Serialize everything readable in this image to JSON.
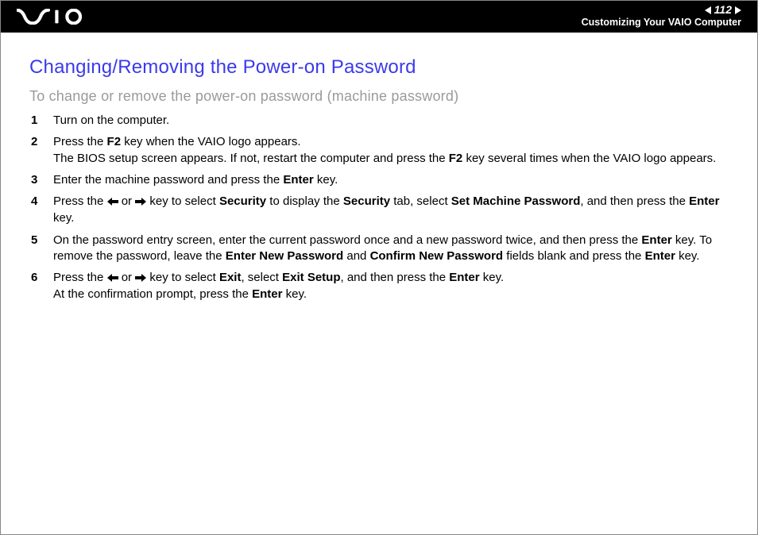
{
  "header": {
    "page_number": "112",
    "breadcrumb": "Customizing Your VAIO Computer"
  },
  "title": "Changing/Removing the Power-on Password",
  "subtitle": "To change or remove the power-on password (machine password)",
  "steps": {
    "s1": "Turn on the computer.",
    "s2": {
      "a": "Press the ",
      "b": "F2",
      "c": " key when the VAIO logo appears.",
      "d": "The BIOS setup screen appears. If not, restart the computer and press the ",
      "e": "F2",
      "f": " key several times when the VAIO logo appears."
    },
    "s3": {
      "a": "Enter the machine password and press the ",
      "b": "Enter",
      "c": " key."
    },
    "s4": {
      "a": "Press the ",
      "or": " or ",
      "b": " key to select ",
      "sec": "Security",
      "c": " to display the ",
      "sec2": "Security",
      "d": " tab, select ",
      "smp": "Set Machine Password",
      "e": ", and then press the ",
      "enter": "Enter",
      "f": " key."
    },
    "s5": {
      "a": "On the password entry screen, enter the current password once and a new password twice, and then press the ",
      "enter": "Enter",
      "b": " key. To remove the password, leave the ",
      "enp": "Enter New Password",
      "c": " and ",
      "cnp": "Confirm New Password",
      "d": " fields blank and press the ",
      "enter2": "Enter",
      "e": " key."
    },
    "s6": {
      "a": "Press the ",
      "or": " or ",
      "b": " key to select ",
      "exit": "Exit",
      "c": ", select ",
      "exitsetup": "Exit Setup",
      "d": ", and then press the ",
      "enter": "Enter",
      "e": " key.",
      "f": "At the confirmation prompt, press the ",
      "enter2": "Enter",
      "g": " key."
    }
  }
}
